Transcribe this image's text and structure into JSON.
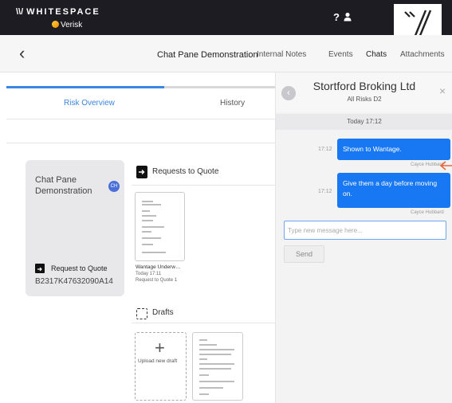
{
  "header": {
    "logo_text": "WHITESPACE",
    "logo_mark": "\\\\/",
    "sub_brand": "Verisk",
    "help_label": "?",
    "brand_tile_mark": "\\\\/",
    "icons": [
      "help-icon",
      "user-icon"
    ]
  },
  "nav": {
    "back_label": "‹",
    "title": "Chat Pane Demonstration",
    "links": [
      "Internal Notes",
      "Events",
      "Chats",
      "Attachments"
    ],
    "active_link": "Chats"
  },
  "tabs": {
    "risk_overview": "Risk Overview",
    "history": "History"
  },
  "card": {
    "title": "Chat Pane Demonstration",
    "avatar_initials": "CH",
    "doc_label": "Request to Quote",
    "reference": "B2317K47632090A14"
  },
  "requests_section": {
    "title": "Requests to Quote",
    "doc_name": "Wantage Underw…",
    "doc_time": "Today 17:11",
    "doc_caption": "Request to Quote 1"
  },
  "drafts_section": {
    "title": "Drafts",
    "upload_label": "Upload new draft"
  },
  "chat": {
    "title": "Stortford Broking Ltd",
    "subtitle": "All Risks D2",
    "close_label": "×",
    "back_label": "‹",
    "date_separator": "Today 17:12",
    "messages": [
      {
        "time": "17:12",
        "text": "Shown to Wantage.",
        "sender": "Cayce Hubbard"
      },
      {
        "time": "17:12",
        "text": "Give them a day before moving on.",
        "sender": "Cayce Hubbard"
      }
    ],
    "input_placeholder": "Type new message here...",
    "send_label": "Send"
  },
  "colors": {
    "accent": "#1877f2",
    "topbar": "#1c1c22",
    "arrow": "#e8683a"
  }
}
